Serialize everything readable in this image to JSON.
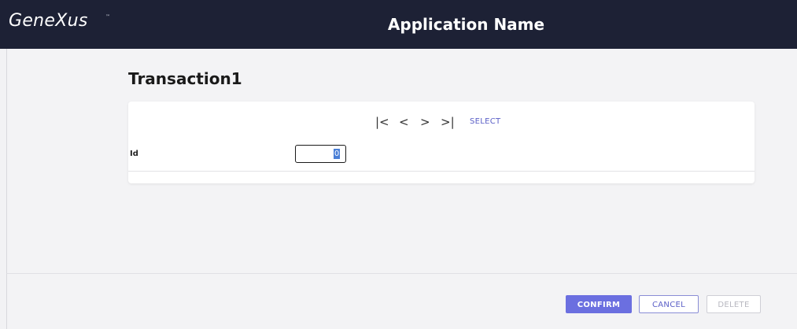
{
  "header": {
    "logo_text": "GeneXus",
    "logo_tm": "™",
    "app_name": "Application Name"
  },
  "page": {
    "title": "Transaction1"
  },
  "navigation": {
    "first_icon": "|<",
    "prev_icon": "<",
    "next_icon": ">",
    "last_icon": ">|",
    "select_label": "SELECT"
  },
  "form": {
    "id_label": "Id",
    "id_value": "0"
  },
  "actions": {
    "confirm_label": "CONFIRM",
    "cancel_label": "CANCEL",
    "delete_label": "DELETE"
  },
  "colors": {
    "header_bg": "#1d2135",
    "accent": "#6b6fe0",
    "link": "#5b5fc7"
  }
}
